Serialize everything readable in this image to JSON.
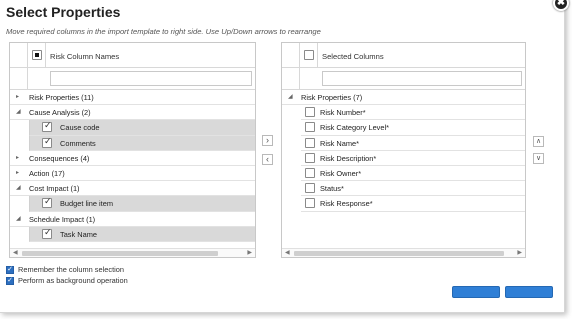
{
  "dialog": {
    "title": "Select Properties",
    "subtitle": "Move required columns in the import template to right side. Use Up/Down arrows to rearrange",
    "close_icon": "✖"
  },
  "left_panel": {
    "header_label": "Risk Column Names",
    "filter_value": "",
    "rows": [
      {
        "kind": "group",
        "expanded": false,
        "label": "Risk Properties (11)"
      },
      {
        "kind": "group",
        "expanded": true,
        "label": "Cause Analysis (2)"
      },
      {
        "kind": "item",
        "checked": true,
        "label": "Cause code"
      },
      {
        "kind": "item",
        "checked": true,
        "label": "Comments"
      },
      {
        "kind": "group",
        "expanded": false,
        "label": "Consequences (4)"
      },
      {
        "kind": "group",
        "expanded": false,
        "label": "Action (17)"
      },
      {
        "kind": "group",
        "expanded": true,
        "label": "Cost Impact (1)"
      },
      {
        "kind": "item",
        "checked": true,
        "label": "Budget line item"
      },
      {
        "kind": "group",
        "expanded": true,
        "label": "Schedule Impact (1)"
      },
      {
        "kind": "item",
        "checked": true,
        "label": "Task Name"
      }
    ]
  },
  "right_panel": {
    "header_label": "Selected Columns",
    "filter_value": "",
    "rows": [
      {
        "kind": "group",
        "expanded": true,
        "label": "Risk Properties (7)"
      },
      {
        "kind": "ritem",
        "checked": false,
        "label": "Risk Number*"
      },
      {
        "kind": "ritem",
        "checked": false,
        "label": "Risk Category Level*"
      },
      {
        "kind": "ritem",
        "checked": false,
        "label": "Risk Name*"
      },
      {
        "kind": "ritem",
        "checked": false,
        "label": "Risk Description*"
      },
      {
        "kind": "ritem",
        "checked": false,
        "label": "Risk Owner*"
      },
      {
        "kind": "ritem",
        "checked": false,
        "label": "Status*"
      },
      {
        "kind": "ritem",
        "checked": false,
        "label": "Risk Response*"
      }
    ]
  },
  "move_buttons": {
    "right": "›",
    "left": "‹"
  },
  "order_buttons": {
    "up": "∧",
    "down": "∨"
  },
  "scroll_arrows": {
    "left": "◀",
    "right": "▶"
  },
  "expander_icons": {
    "expanded": "◢",
    "collapsed": "▸"
  },
  "options": {
    "remember_label": "Remember the column selection",
    "remember_checked": true,
    "background_label": "Perform as background operation",
    "background_checked": true
  },
  "colors": {
    "accent": "#2f7fd6",
    "selected_row": "#d9d9d9"
  }
}
